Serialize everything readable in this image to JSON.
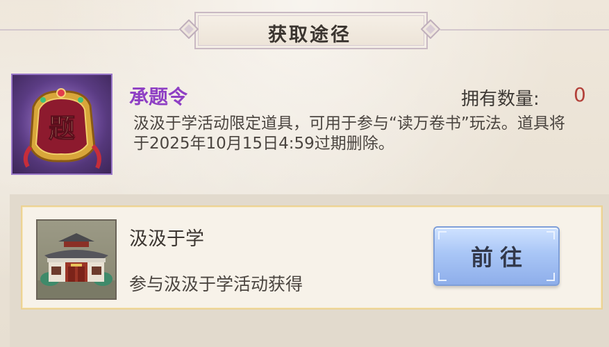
{
  "dialog": {
    "title": "获取途径"
  },
  "item": {
    "name": "承题令",
    "icon": "scroll-token-icon",
    "icon_glyph": "题",
    "owned_label": "拥有数量:",
    "owned_value": "0",
    "description": "汲汲于学活动限定道具，可用于参与“读万卷书”玩法。道具将于2025年10月15日4:59过期删除。"
  },
  "sources": [
    {
      "title": "汲汲于学",
      "description": "参与汲汲于学活动获得",
      "icon": "academy-building-icon",
      "button_label": "前往"
    }
  ],
  "colors": {
    "item_name": "#8e3fc4",
    "owned_value": "#b3413a",
    "go_button": "#a9c6f6",
    "card_border": "#ecd394"
  }
}
